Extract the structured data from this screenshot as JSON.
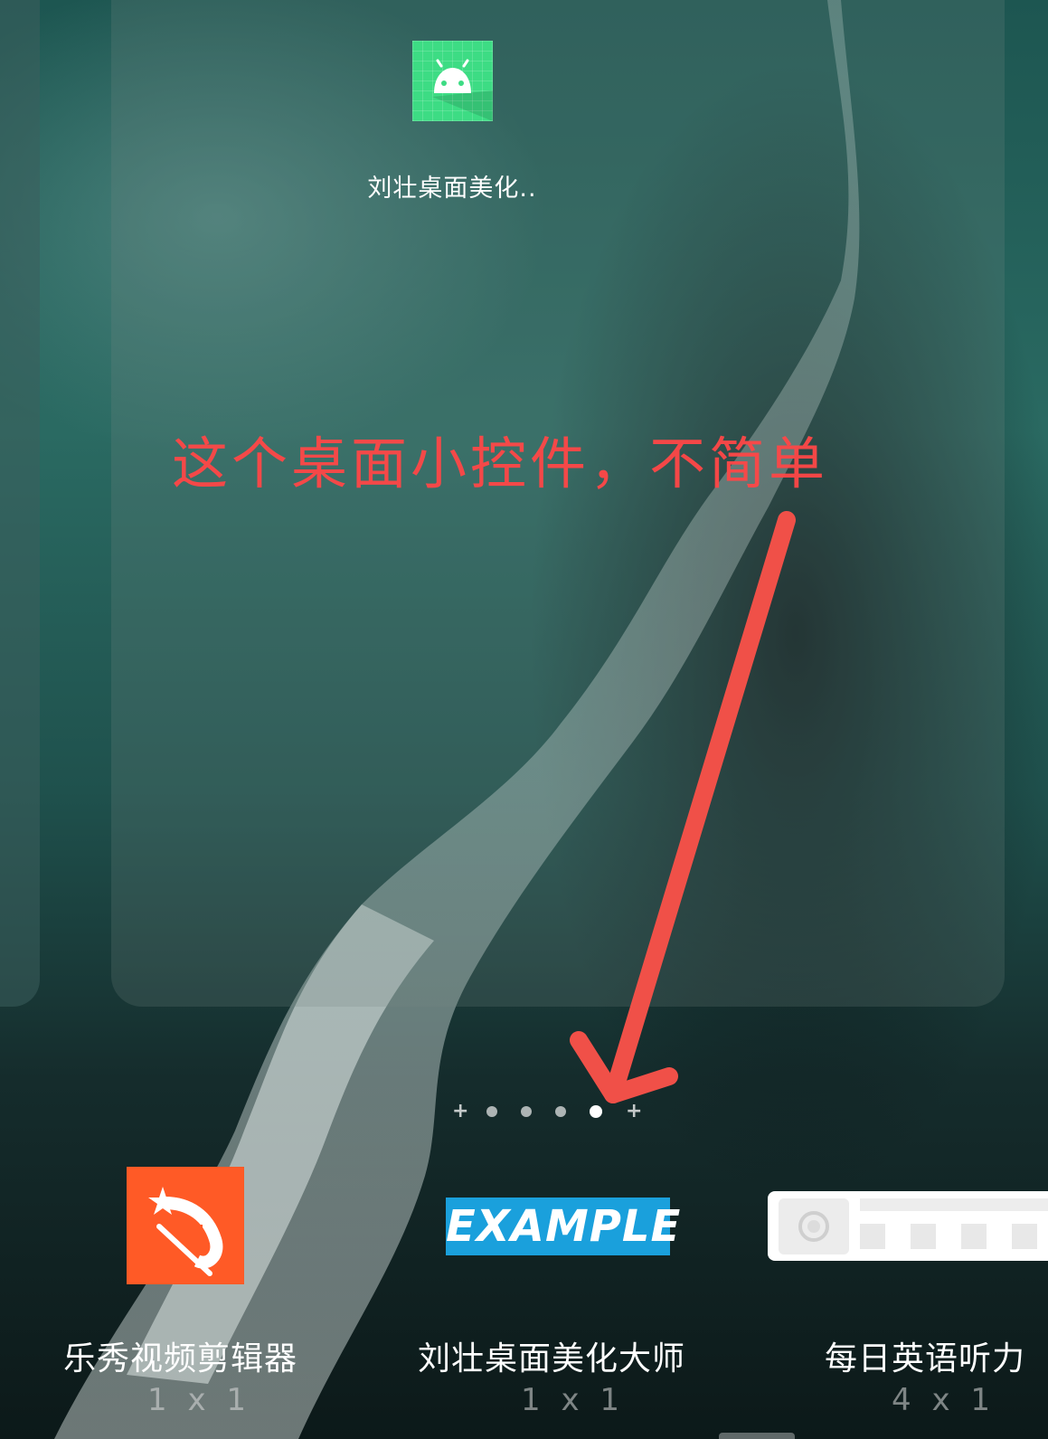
{
  "preview": {
    "app_label": "刘壮桌面美化..",
    "app_icon": "android-robot-icon"
  },
  "annotation": {
    "text": "这个桌面小控件，不简单",
    "color": "#ff4747"
  },
  "pager": {
    "dots": [
      "plus",
      "dot",
      "dot",
      "dot",
      "active",
      "plus"
    ]
  },
  "widgets": [
    {
      "name": "乐秀视频剪辑器",
      "size": "1 x 1",
      "thumb_icon": "video-editor-icon"
    },
    {
      "name": "刘壮桌面美化大师",
      "size": "1 x 1",
      "thumb_text": "EXAMPLE"
    },
    {
      "name": "每日英语听力",
      "size": "4 x 1",
      "thumb_icon": "audio-player-widget-icon"
    }
  ],
  "colors": {
    "android_green": "#3ddc84",
    "example_blue": "#1aa0dc",
    "video_orange": "#ff5a26"
  }
}
